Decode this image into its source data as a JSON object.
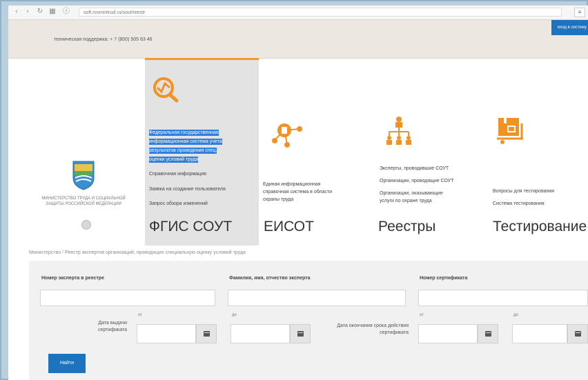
{
  "browser": {
    "address": "soft.rosmintrud.ru/sout/reestr",
    "menu_glyph": "≡"
  },
  "header": {
    "support_text": "техническая поддержка: + 7 (800) 505 63 46",
    "login_label": "вход в систему"
  },
  "ministry": {
    "name": "МИНИСТЕРСТВО ТРУДА И СОЦИАЛЬНОЙ ЗАЩИТЫ РОССИЙСКОЙ ФЕДЕРАЦИИ"
  },
  "tiles": [
    {
      "title": "ФГИС СОУТ",
      "icon": "magnifier-chart-icon",
      "links": [
        "Федеральная государственная",
        "информационная система учета",
        "результатов проведения спец.",
        "оценки условий труда",
        "Справочная информация",
        "Заявка на создание пользователя",
        "Запрос обзора изменений"
      ]
    },
    {
      "title": "ЕИСОТ",
      "icon": "network-nodes-icon",
      "links": [
        "Единая информационная",
        "справочная система в области",
        "охраны труда"
      ]
    },
    {
      "title": "Реестры",
      "icon": "hierarchy-icon",
      "links": [
        "Эксперты, проводившие СОУТ",
        "Организации, проводящие СОУТ",
        "Организации, оказывающие",
        "услуги по охране труда"
      ]
    },
    {
      "title": "Тестирование",
      "icon": "truck-box-icon",
      "links": [
        "Вопросы для тестирования",
        "Система тестирования"
      ]
    }
  ],
  "breadcrumb": {
    "root": "Министерство",
    "current": "Реестр экспертов организаций, проводящих специальную оценку условий труда"
  },
  "filter": {
    "expert_number_label": "Номер эксперта в реестре",
    "fio_label": "Фамилия, имя, отчество эксперта",
    "certificate_number_label": "Номер сертификата",
    "issue_date_label": "Дата выдачи сертификата",
    "expiry_date_label": "Дата окончания срока действия сертификата",
    "from_label": "от",
    "to_label": "до",
    "find_button": "Найти"
  },
  "colors": {
    "accent": "#1e73be",
    "tile_active_border": "#f59a2b",
    "icon_orange": "#f29124",
    "selection": "#2f7fe0"
  }
}
